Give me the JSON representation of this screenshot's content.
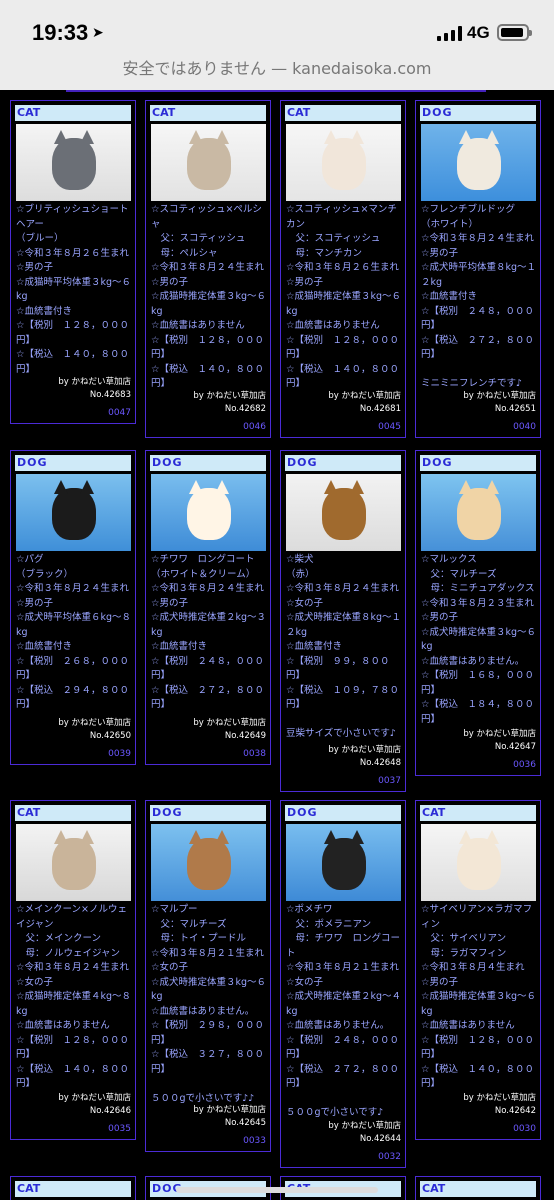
{
  "status": {
    "time": "19:33",
    "network": "4G"
  },
  "browser": {
    "url_text": "安全ではありません — kanedaisoka.com"
  },
  "pets": [
    {
      "tag": "CAT",
      "desc": "☆ブリティッシュショートヘアー\n（ブルー）\n☆令和３年８月２６生まれ\n☆男の子\n☆成猫時平均体重３kg〜６kg\n☆血統書付き\n☆【税別　１２８，０００円】\n☆【税込　１４０，８００円】",
      "shop": "by かねだい草加店",
      "no": "No.42683",
      "num": "0047"
    },
    {
      "tag": "CAT",
      "desc": "☆スコティッシュ×ペルシャ\n　父：スコティッシュ\n　母：ペルシャ\n☆令和３年８月２４生まれ\n☆男の子\n☆成猫時推定体重３kg〜６kg\n☆血統書はありません\n☆【税別　１２８，０００円】\n☆【税込　１４０，８００円】",
      "shop": "by かねだい草加店",
      "no": "No.42682",
      "num": "0046"
    },
    {
      "tag": "CAT",
      "desc": "☆スコティッシュ×マンチカン\n　父：スコティッシュ\n　母：マンチカン\n☆令和３年８月２６生まれ\n☆男の子\n☆成猫時推定体重３kg〜６kg\n☆血統書はありません\n☆【税別　１２８，０００円】\n☆【税込　１４０，８００円】",
      "shop": "by かねだい草加店",
      "no": "No.42681",
      "num": "0045"
    },
    {
      "tag": "DOG",
      "desc": "☆フレンチブルドッグ\n（ホワイト）\n☆令和３年８月２４生まれ\n☆男の子\n☆成犬時平均体重８kg〜１２kg\n☆血統書付き\n☆【税別　２４８，０００円】\n☆【税込　２７２，８００円】\n\nミニミニフレンチです♪",
      "shop": "by かねだい草加店",
      "no": "No.42651",
      "num": "0040"
    },
    {
      "tag": "DOG",
      "desc": "☆パグ\n（ブラック）\n☆令和３年８月２４生まれ\n☆男の子\n☆成犬時平均体重６kg〜８kg\n☆血統書付き\n☆【税別　２６８，０００円】\n☆【税込　２９４，８００円】",
      "shop": "by かねだい草加店",
      "no": "No.42650",
      "num": "0039"
    },
    {
      "tag": "DOG",
      "desc": "☆チワワ　ロングコート\n（ホワイト＆クリーム）\n☆令和３年８月２４生まれ\n☆男の子\n☆成犬時推定体重２kg〜３kg\n☆血統書付き\n☆【税別　２４８，０００円】\n☆【税込　２７２，８００円】",
      "shop": "by かねだい草加店",
      "no": "No.42649",
      "num": "0038"
    },
    {
      "tag": "DOG",
      "desc": "☆柴犬\n（赤）\n☆令和３年８月２４生まれ\n☆女の子\n☆成犬時推定体重８kg〜１２kg\n☆血統書付き\n☆【税別　９９，８００円】\n☆【税込　１０９，７８０円】\n\n豆柴サイズで小さいです♪",
      "shop": "by かねだい草加店",
      "no": "No.42648",
      "num": "0037"
    },
    {
      "tag": "DOG",
      "desc": "☆マルックス\n　父：マルチーズ\n　母：ミニチュアダックス\n☆令和３年８月２３生まれ\n☆男の子\n☆成犬時推定体重３kg〜６kg\n☆血統書はありません。\n☆【税別　１６８，０００円】\n☆【税込　１８４，８００円】",
      "shop": "by かねだい草加店",
      "no": "No.42647",
      "num": "0036"
    },
    {
      "tag": "CAT",
      "desc": "☆メインクーン×ノルウェイジャン\n　父：メインクーン\n　母：ノルウェイジャン\n☆令和３年８月２４生まれ\n☆女の子\n☆成猫時推定体重４kg〜８kg\n☆血統書はありません\n☆【税別　１２８，０００円】\n☆【税込　１４０，８００円】",
      "shop": "by かねだい草加店",
      "no": "No.42646",
      "num": "0035"
    },
    {
      "tag": "DOG",
      "desc": "☆マルプー\n　父：マルチーズ\n　母：トイ・プードル\n☆令和３年８月２１生まれ\n☆女の子\n☆成犬時推定体重３kg〜６kg\n☆血統書はありません。\n☆【税別　２９８，０００円】\n☆【税込　３２７，８００円】\n\n５００gで小さいです♪♪",
      "shop": "by かねだい草加店",
      "no": "No.42645",
      "num": "0033"
    },
    {
      "tag": "DOG",
      "desc": "☆ポメチワ\n　父：ポメラニアン\n　母：チワワ　ロングコート\n☆令和３年８月２１生まれ\n☆女の子\n☆成犬時推定体重２kg〜４kg\n☆血統書はありません。\n☆【税別　２４８，０００円】\n☆【税込　２７２，８００円】\n\n５００gで小さいです♪",
      "shop": "by かねだい草加店",
      "no": "No.42644",
      "num": "0032"
    },
    {
      "tag": "CAT",
      "desc": "☆サイベリアン×ラガマフィン\n　父：サイベリアン\n　母：ラガマフィン\n☆令和３年８月４生まれ\n☆男の子\n☆成猫時推定体重３kg〜６kg\n☆血統書はありません\n☆【税別　１２８，０００円】\n☆【税込　１４０，８００円】",
      "shop": "by かねだい草加店",
      "no": "No.42642",
      "num": "0030"
    }
  ],
  "next_row_tags": [
    "CAT",
    "DOG",
    "CAT",
    "CAT"
  ],
  "colors": {
    "card_border": "#4b2bd6",
    "tag_bg": "#cfeaf8",
    "tag_text": "#2b2bd6",
    "desc_text": "#9aa5ff",
    "number_text": "#6b58ff",
    "page_bg": "#000000"
  }
}
